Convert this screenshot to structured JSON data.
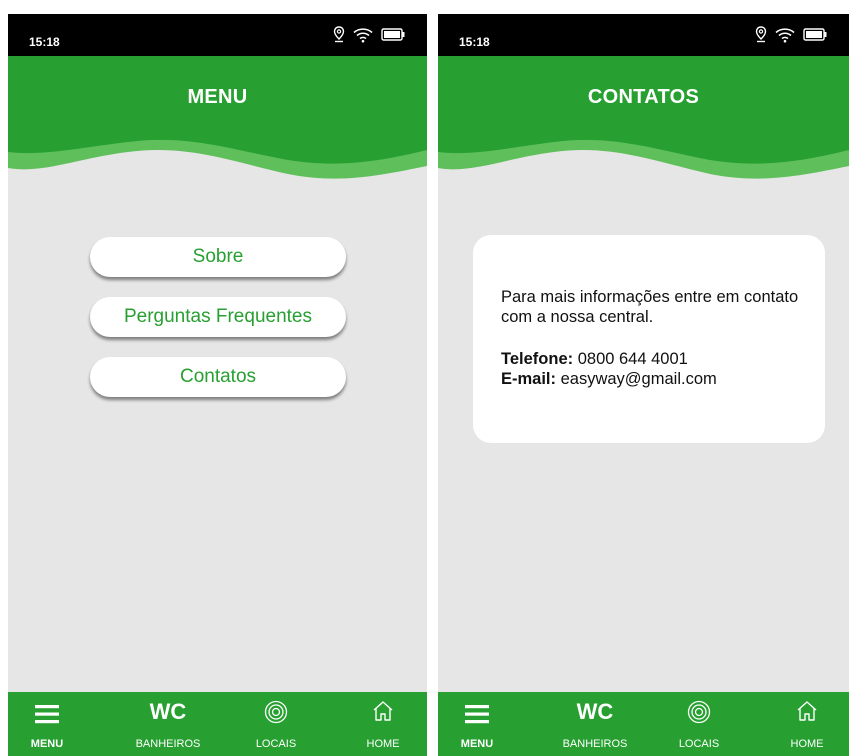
{
  "status_bar": {
    "time": "15:18"
  },
  "left_screen": {
    "title": "MENU",
    "menu_items": [
      "Sobre",
      "Perguntas Frequentes",
      "Contatos"
    ]
  },
  "right_screen": {
    "title": "CONTATOS",
    "message": "Para mais informações entre em contato com a nossa central.",
    "phone_label": "Telefone:",
    "phone": "0800 644 4001",
    "email_label": "E-mail:",
    "email": "easyway@gmail.com"
  },
  "bottom_nav": {
    "wc_glyph": "WC",
    "items": [
      {
        "label": "MENU",
        "icon": "hamburger-icon"
      },
      {
        "label": "BANHEIROS",
        "icon": "wc-icon"
      },
      {
        "label": "LOCAIS",
        "icon": "target-icon"
      },
      {
        "label": "HOME",
        "icon": "home-icon"
      }
    ]
  },
  "colors": {
    "header_green": "#27a031",
    "wave_light_green": "#5fc05b",
    "background": "#e6e6e6",
    "button_text": "#27a031"
  }
}
